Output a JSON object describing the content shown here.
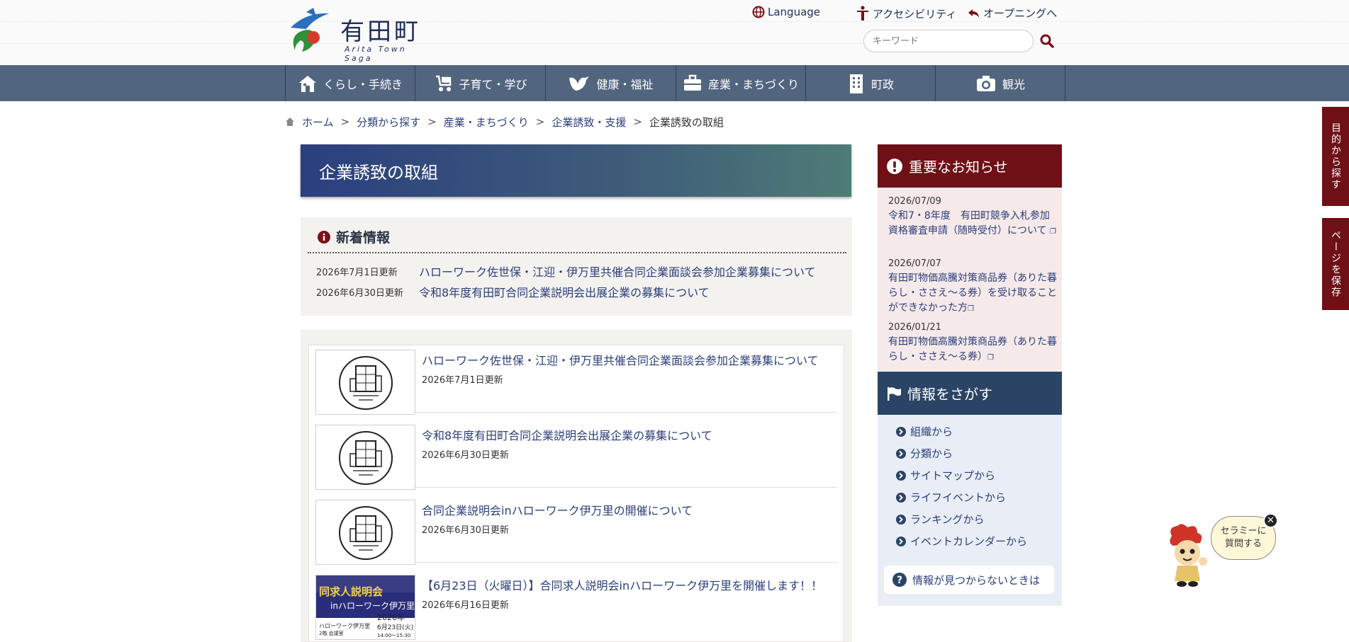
{
  "brand": {
    "name": "有田町",
    "sub": "Arita Town Saga"
  },
  "utility": {
    "language": "Language",
    "accessibility": "アクセシビリティ",
    "opening": "オープニングへ",
    "search_placeholder": "キーワード"
  },
  "gnav": [
    {
      "label": "くらし・手続き",
      "icon": "house-icon"
    },
    {
      "label": "子育て・学び",
      "icon": "stroller-icon"
    },
    {
      "label": "健康・福祉",
      "icon": "bird-icon"
    },
    {
      "label": "産業・まちづくり",
      "icon": "briefcase-icon"
    },
    {
      "label": "町政",
      "icon": "building-icon"
    },
    {
      "label": "観光",
      "icon": "camera-icon"
    }
  ],
  "breadcrumb": {
    "home": "ホーム",
    "items": [
      "分類から探す",
      "産業・まちづくり",
      "企業誘致・支援"
    ],
    "current": "企業誘致の取組",
    "separator": ">"
  },
  "page": {
    "title": "企業誘致の取組"
  },
  "news": {
    "heading": "新着情報",
    "items": [
      {
        "date": "2026年7月1日更新",
        "title": "ハローワーク佐世保・江迎・伊万里共催合同企業面談会参加企業募集について"
      },
      {
        "date": "2026年6月30日更新",
        "title": "令和8年度有田町合同企業説明会出展企業の募集について"
      }
    ]
  },
  "cards": [
    {
      "title": "ハローワーク佐世保・江迎・伊万里共催合同企業面談会参加企業募集について",
      "date": "2026年7月1日更新"
    },
    {
      "title": "令和8年度有田町合同企業説明会出展企業の募集について",
      "date": "2026年6月30日更新"
    },
    {
      "title": "合同企業説明会inハローワーク伊万里の開催について",
      "date": "2026年6月30日更新"
    },
    {
      "title": "【6月23日（火曜日）】合同求人説明会inハローワーク伊万里を開催します！！",
      "date": "2026年6月16日更新",
      "thumb": {
        "l1": "同求人説明会",
        "l2": "inハローワーク伊万里",
        "year": "2026年",
        "day": "6月23日(火)",
        "place": "ハローワーク伊万里",
        "room": "2階 会議室",
        "time": "14:00〜15:30"
      }
    }
  ],
  "notice": {
    "heading": "重要なお知らせ",
    "items": [
      {
        "date": "2026/07/09",
        "title": "令和7・8年度　有田町競争入札参加資格審査申請（随時受付）について"
      },
      {
        "date": "2026/07/07",
        "title": "有田町物価高騰対策商品券（ありた暮らし・ささえ〜る券）を受け取ることができなかった方"
      },
      {
        "date": "2026/01/21",
        "title": "有田町物価高騰対策商品券（ありた暮らし・ささえ〜る券）"
      }
    ]
  },
  "find": {
    "heading": "情報をさがす",
    "items": [
      "組織から",
      "分類から",
      "サイトマップから",
      "ライフイベントから",
      "ランキングから",
      "イベントカレンダーから"
    ],
    "help": "情報が見つからないときは"
  },
  "side_tabs": {
    "purpose": "目的から探す",
    "save": "ページを保存"
  },
  "chatbot": {
    "line1": "セラミーに",
    "line2": "質問する"
  },
  "colors": {
    "nav": "#52657f",
    "notice": "#6e1015",
    "find": "#2b4466",
    "link": "#2b3e7a"
  }
}
